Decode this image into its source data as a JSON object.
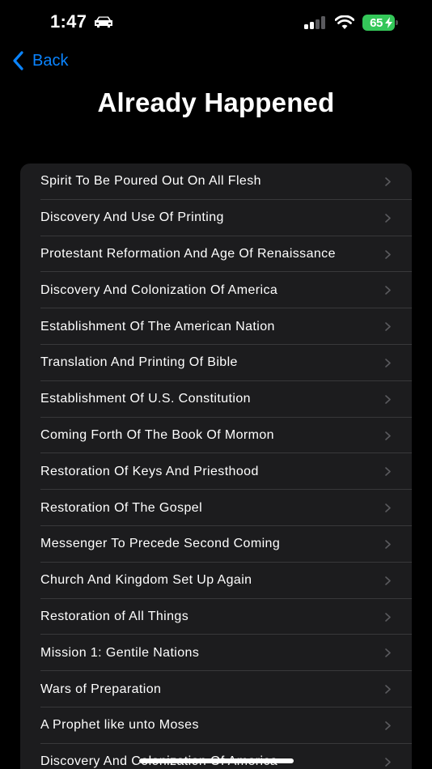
{
  "status_bar": {
    "time": "1:47",
    "battery_level": "65"
  },
  "nav": {
    "back_label": "Back"
  },
  "page": {
    "title": "Already Happened"
  },
  "list": {
    "items": [
      {
        "label": "Spirit To Be Poured Out On All Flesh"
      },
      {
        "label": "Discovery And Use Of Printing"
      },
      {
        "label": "Protestant Reformation And Age Of Renaissance"
      },
      {
        "label": "Discovery And Colonization Of America"
      },
      {
        "label": "Establishment Of The American Nation"
      },
      {
        "label": "Translation And Printing Of Bible"
      },
      {
        "label": "Establishment Of U.S. Constitution"
      },
      {
        "label": "Coming Forth Of The Book Of Mormon"
      },
      {
        "label": "Restoration Of Keys And Priesthood"
      },
      {
        "label": "Restoration Of The Gospel"
      },
      {
        "label": "Messenger To Precede Second Coming"
      },
      {
        "label": "Church And Kingdom Set Up Again"
      },
      {
        "label": "Restoration of All Things"
      },
      {
        "label": "Mission 1: Gentile Nations"
      },
      {
        "label": "Wars of Preparation"
      },
      {
        "label": "A Prophet like unto Moses"
      },
      {
        "label": "Discovery And Colonization Of America"
      }
    ]
  },
  "colors": {
    "background": "#000000",
    "row_background": "#1c1c1e",
    "accent": "#0a84ff",
    "separator": "#38383a",
    "chevron": "#5a5a5e",
    "battery": "#34c759"
  }
}
